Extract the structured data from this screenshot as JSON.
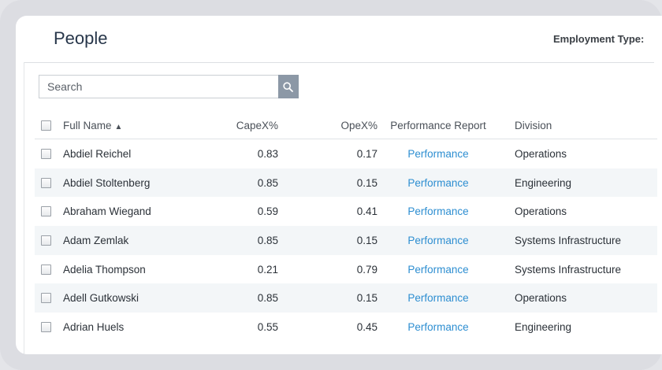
{
  "header": {
    "title": "People",
    "employment_type_label": "Employment Type:"
  },
  "search": {
    "placeholder": "Search",
    "icon": "search-icon"
  },
  "table": {
    "columns": {
      "full_name": "Full Name",
      "sort_indicator": "▲",
      "capex": "CapeX%",
      "opex": "OpeX%",
      "performance": "Performance Report",
      "division": "Division"
    },
    "rows": [
      {
        "name": "Abdiel Reichel",
        "capex": "0.83",
        "opex": "0.17",
        "performance": "Performance",
        "division": "Operations"
      },
      {
        "name": "Abdiel Stoltenberg",
        "capex": "0.85",
        "opex": "0.15",
        "performance": "Performance",
        "division": "Engineering"
      },
      {
        "name": "Abraham Wiegand",
        "capex": "0.59",
        "opex": "0.41",
        "performance": "Performance",
        "division": "Operations"
      },
      {
        "name": "Adam Zemlak",
        "capex": "0.85",
        "opex": "0.15",
        "performance": "Performance",
        "division": "Systems Infrastructure"
      },
      {
        "name": "Adelia Thompson",
        "capex": "0.21",
        "opex": "0.79",
        "performance": "Performance",
        "division": "Systems Infrastructure"
      },
      {
        "name": "Adell Gutkowski",
        "capex": "0.85",
        "opex": "0.15",
        "performance": "Performance",
        "division": "Operations"
      },
      {
        "name": "Adrian Huels",
        "capex": "0.55",
        "opex": "0.45",
        "performance": "Performance",
        "division": "Engineering"
      }
    ]
  },
  "colors": {
    "link": "#2d8ed1",
    "search_button": "#8c98a6",
    "row_alt": "#f3f6f8"
  }
}
